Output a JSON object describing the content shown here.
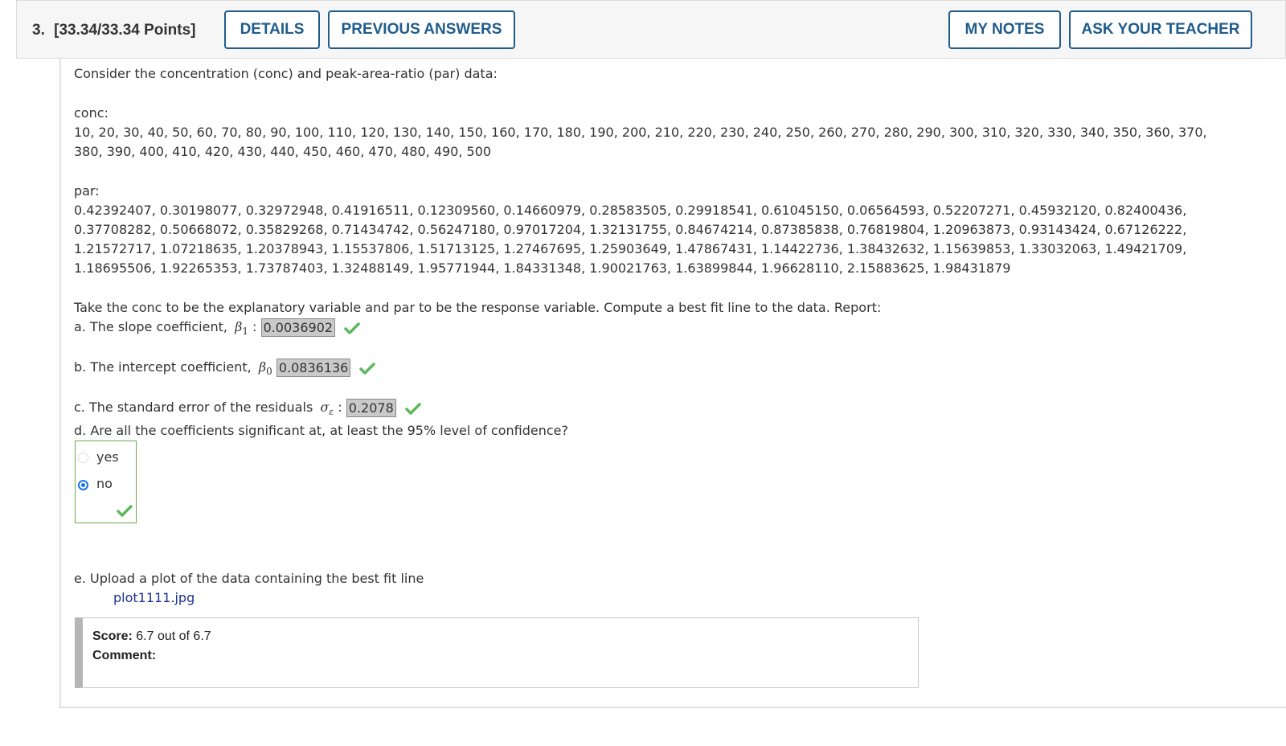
{
  "header": {
    "question_number": "3.",
    "points": "[33.34/33.34 Points]",
    "buttons": {
      "details": "DETAILS",
      "previous_answers": "PREVIOUS ANSWERS",
      "my_notes": "MY NOTES",
      "ask_teacher": "ASK YOUR TEACHER"
    }
  },
  "question": {
    "intro": "Consider the concentration (conc) and peak-area-ratio (par) data:",
    "conc_label": "conc:",
    "conc_lines": [
      "10, 20, 30, 40, 50, 60, 70, 80, 90, 100, 110, 120, 130, 140, 150, 160, 170, 180, 190, 200, 210, 220, 230, 240, 250, 260, 270, 280, 290, 300, 310, 320, 330, 340, 350, 360, 370,",
      "380, 390, 400, 410, 420, 430, 440, 450, 460, 470, 480, 490, 500"
    ],
    "par_label": "par:",
    "par_lines": [
      "0.42392407, 0.30198077, 0.32972948, 0.41916511, 0.12309560, 0.14660979, 0.28583505, 0.29918541, 0.61045150, 0.06564593, 0.52207271, 0.45932120, 0.82400436,",
      "0.37708282, 0.50668072, 0.35829268, 0.71434742, 0.56247180, 0.97017204, 1.32131755, 0.84674214, 0.87385838, 0.76819804, 1.20963873, 0.93143424, 0.67126222,",
      "1.21572717, 1.07218635, 1.20378943, 1.15537806, 1.51713125, 1.27467695, 1.25903649, 1.47867431, 1.14422736, 1.38432632, 1.15639853, 1.33032063, 1.49421709,",
      "1.18695506, 1.92265353, 1.73787403, 1.32488149, 1.95771944, 1.84331348, 1.90021763, 1.63899844, 1.96628110, 2.15883625, 1.98431879"
    ],
    "instructions": "Take the conc to be the explanatory variable and par to be the response variable. Compute a best fit line to the data. Report:",
    "part_a": {
      "prefix": "a. The slope coefficient,",
      "symbol": "β",
      "subscript": "1",
      "colon": ":",
      "answer": "0.0036902"
    },
    "part_b": {
      "prefix": "b. The intercept coefficient,",
      "symbol": "β",
      "subscript": "0",
      "answer": "0.0836136"
    },
    "part_c": {
      "prefix": "c. The standard error of the residuals",
      "symbol": "σ",
      "subscript": "ε",
      "colon": ":",
      "answer": "0.2078"
    },
    "part_d": {
      "prompt": "d. Are all the coefficients significant at, at least the 95% level of confidence?",
      "options": [
        "yes",
        "no"
      ],
      "selected": "no"
    },
    "part_e": {
      "prompt": "e. Upload a plot of the data containing the best fit line",
      "file": "plot1111.jpg"
    }
  },
  "score": {
    "score_label": "Score:",
    "score_value": "6.7 out of 6.7",
    "comment_label": "Comment:"
  },
  "colors": {
    "button_border": "#1f5c8b",
    "check_green": "#5cb85c",
    "radio_selected": "#1a73e8",
    "link": "#1a2f8c"
  }
}
